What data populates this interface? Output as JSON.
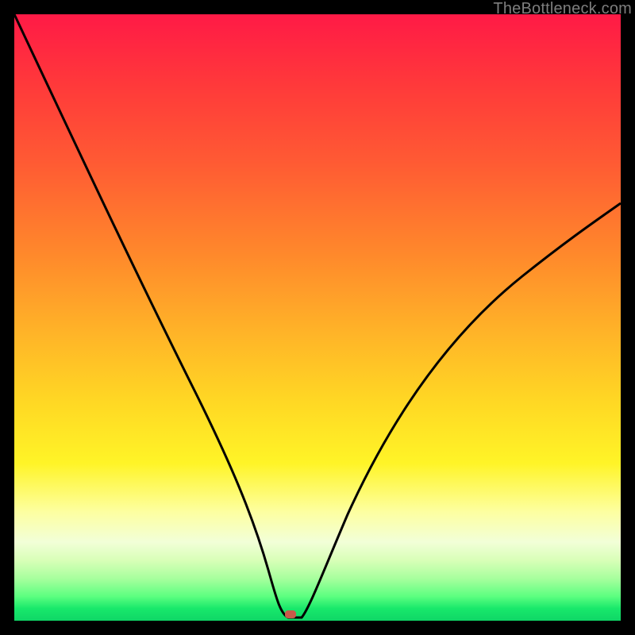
{
  "watermark": "TheBottleneck.com",
  "marker": {
    "x_pct": 45.5,
    "y_pct": 99.0,
    "color": "#c85a4a"
  },
  "chart_data": {
    "type": "line",
    "title": "",
    "xlabel": "",
    "ylabel": "",
    "xlim": [
      0,
      100
    ],
    "ylim": [
      0,
      100
    ],
    "grid": false,
    "legend": false,
    "series": [
      {
        "name": "bottleneck-curve",
        "x": [
          0,
          4,
          9,
          13,
          18,
          22,
          26,
          30,
          34,
          37,
          40,
          42,
          44,
          46,
          48,
          51,
          54,
          58,
          63,
          68,
          74,
          81,
          88,
          95,
          100
        ],
        "y": [
          100,
          89,
          76,
          66,
          55,
          45,
          36,
          28,
          20,
          13,
          7,
          3,
          1,
          0,
          2,
          8,
          15,
          23,
          32,
          40,
          48,
          55,
          61,
          66,
          69
        ]
      }
    ],
    "marker_point": {
      "x": 45.5,
      "y": 0
    }
  }
}
